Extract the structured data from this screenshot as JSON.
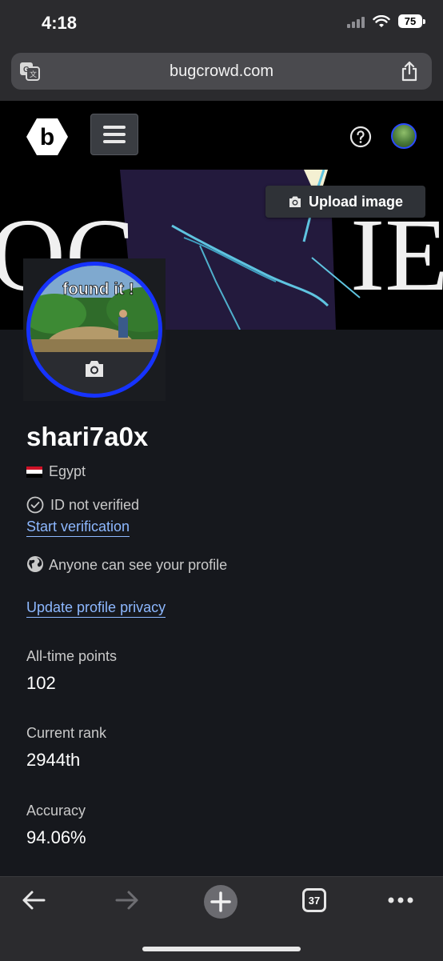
{
  "status_bar": {
    "time": "4:18",
    "battery": "75"
  },
  "browser": {
    "url": "bugcrowd.com",
    "tab_count": "37"
  },
  "header": {
    "logo": "b"
  },
  "banner": {
    "upload_label": "Upload image",
    "art_text_left": "OC",
    "art_text_right": "IE"
  },
  "avatar": {
    "caption": "found it !"
  },
  "profile": {
    "username": "shari7a0x",
    "country": "Egypt",
    "id_status": "ID not verified",
    "verify_link": "Start verification",
    "privacy_text": "Anyone can see your profile",
    "privacy_link": "Update profile privacy"
  },
  "stats": [
    {
      "label": "All-time points",
      "value": "102"
    },
    {
      "label": "Current rank",
      "value": "2944th"
    },
    {
      "label": "Accuracy",
      "value": "94.06%"
    }
  ],
  "colors": {
    "accent_link": "#8db8ff",
    "avatar_ring": "#1633ff",
    "background": "#16181d"
  }
}
